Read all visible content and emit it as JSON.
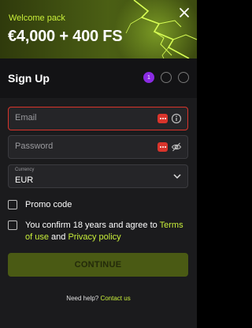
{
  "banner": {
    "label": "Welcome pack",
    "amount": "€4,000 + 400 FS"
  },
  "header": {
    "title": "Sign Up",
    "steps": [
      "1",
      "",
      ""
    ]
  },
  "form": {
    "email_placeholder": "Email",
    "password_placeholder": "Password",
    "currency_label": "Currency",
    "currency_value": "EUR",
    "promo_label": "Promo code",
    "terms_prefix": "You confirm 18 years and agree to ",
    "terms_link": "Terms of use",
    "terms_and": " and ",
    "privacy_link": "Privacy policy",
    "continue_label": "CONTINUE"
  },
  "footer": {
    "help_text": "Need help?",
    "contact_link": "Contact us"
  },
  "colors": {
    "accent": "#c9ef3a",
    "error": "#d9342b",
    "step_active": "#8a2be2",
    "continue_bg": "#4a5a14"
  },
  "icons": [
    "close-icon",
    "keyboard-icon",
    "info-icon",
    "eye-off-icon",
    "chevron-down-icon"
  ]
}
